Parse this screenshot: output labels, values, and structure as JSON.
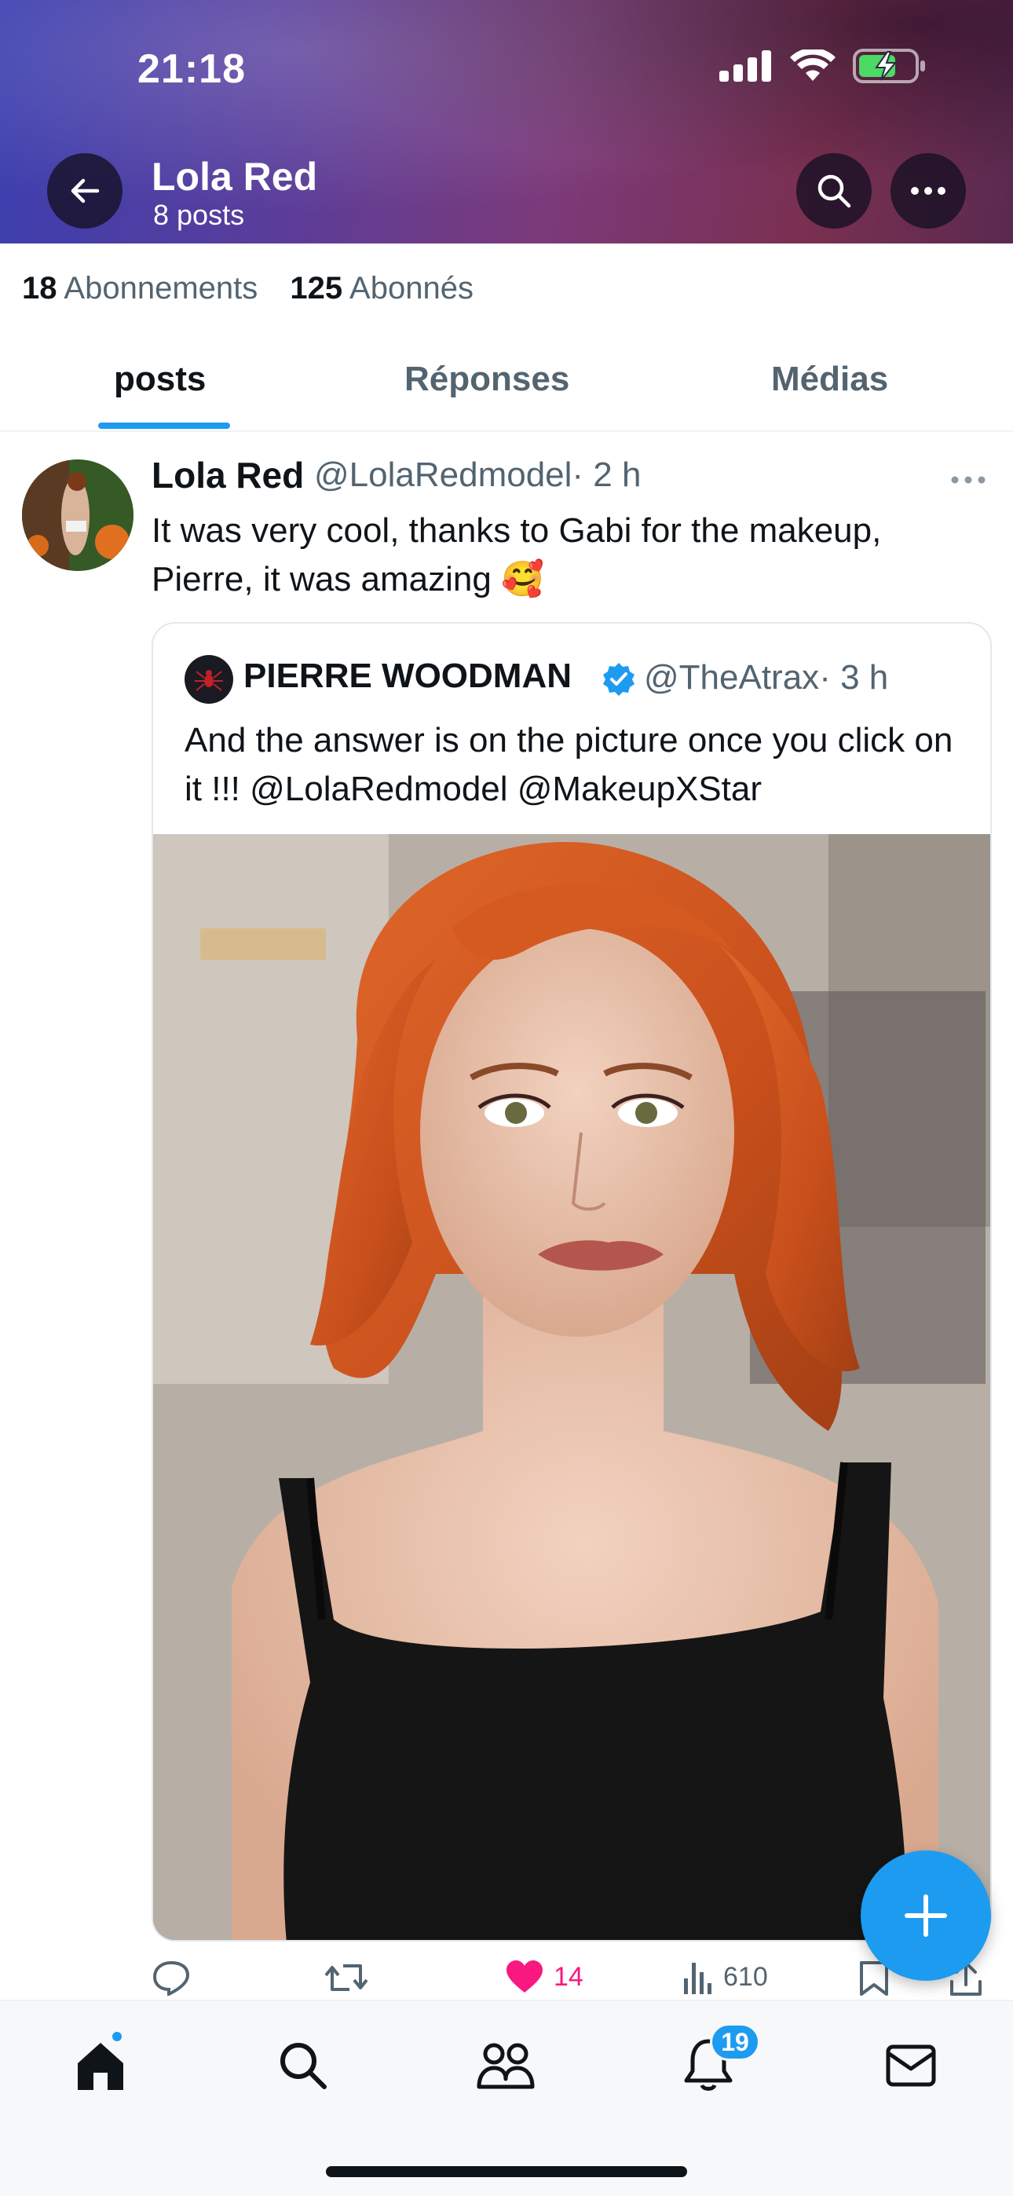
{
  "status_bar": {
    "time": "21:18"
  },
  "header": {
    "name": "Lola Red",
    "posts_count": "8 posts"
  },
  "profile": {
    "following_count": "18",
    "following_label": "Abonnements",
    "followers_count": "125",
    "followers_label": "Abonnés"
  },
  "tabs": [
    {
      "label": "posts",
      "active": true
    },
    {
      "label": "Réponses",
      "active": false
    },
    {
      "label": "Médias",
      "active": false
    }
  ],
  "tweet": {
    "author": "Lola Red",
    "handle": "@LolaRedmodel",
    "time": "· 2 h",
    "text": "It was very cool, thanks to Gabi for the makeup, Pierre, it was amazing 🥰",
    "quote": {
      "author": "PIERRE WOODMAN",
      "verified": true,
      "handle": "@TheAtrax",
      "time": "· 3 h",
      "text": "And the answer is on the picture once you click on it !!! @LolaRedmodel @MakeupXStar"
    },
    "actions": {
      "likes": "14",
      "views": "610",
      "liked": true
    }
  },
  "bottom_nav": {
    "items": [
      "home-icon",
      "search-icon",
      "communities-icon",
      "notifications-icon",
      "messages-icon"
    ],
    "notifications_badge": "19"
  },
  "colors": {
    "accent": "#1d9bf0",
    "like": "#f91880",
    "text": "#0f1419",
    "secondary": "#536471"
  }
}
